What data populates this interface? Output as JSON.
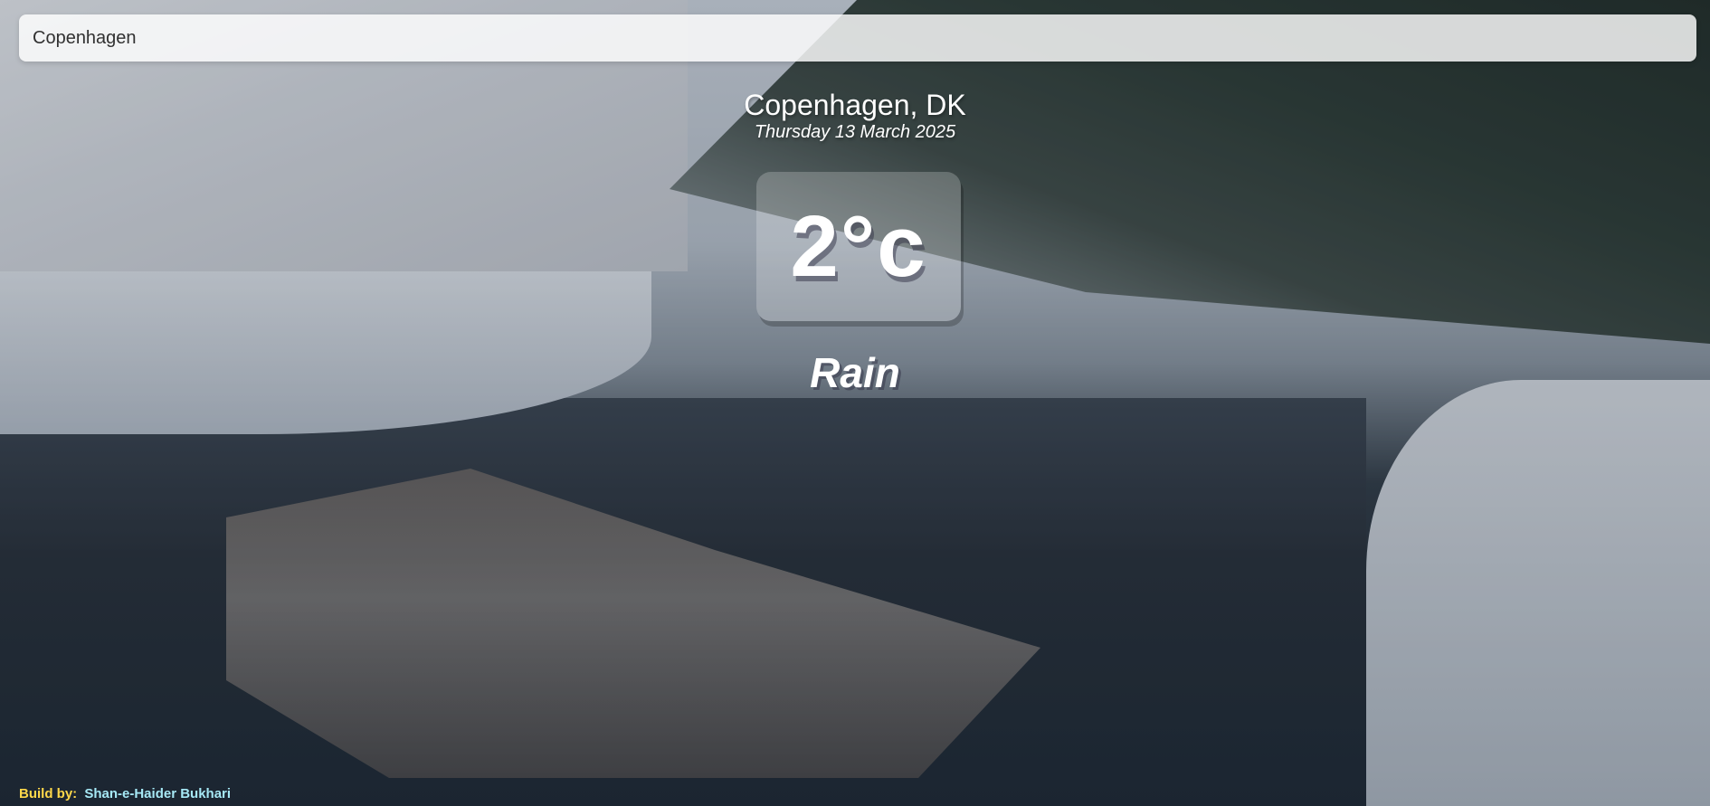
{
  "search": {
    "value": "Copenhagen",
    "placeholder": "Search..."
  },
  "location": {
    "city_country": "Copenhagen, DK",
    "date": "Thursday 13 March 2025"
  },
  "weather": {
    "temperature": "2°c",
    "condition": "Rain"
  },
  "footer": {
    "label": "Build by:",
    "author": "Shan-e-Haider Bukhari"
  },
  "colors": {
    "label": "#ffd84a",
    "author": "#a6e8f5",
    "text": "#ffffff"
  }
}
